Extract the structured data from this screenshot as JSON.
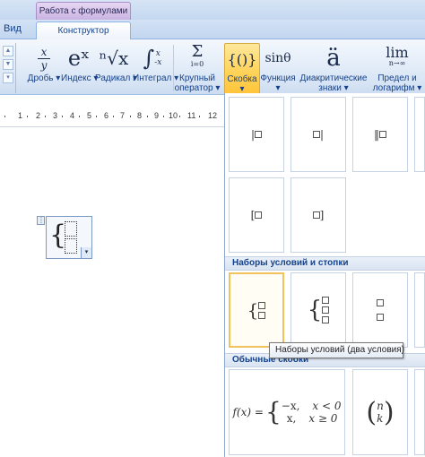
{
  "context_tab": {
    "label": "Работа с формулами"
  },
  "tabs": {
    "vid": "Вид",
    "konstruktor": "Конструктор"
  },
  "ribbon": {
    "buttons": [
      {
        "label": "Дробь",
        "glyph_top": "x",
        "glyph_bottom": "y"
      },
      {
        "label": "Индекс",
        "glyph": "eˣ"
      },
      {
        "label": "Радикал",
        "glyph": "ⁿ√x"
      },
      {
        "label": "Интеграл",
        "glyph": "∫"
      },
      {
        "label": "Крупный оператор",
        "label_line1": "Крупный",
        "label_line2": "оператор",
        "glyph": "Σ",
        "glyph_sub": "i=0"
      },
      {
        "label": "Скобка",
        "glyph": "{()}"
      },
      {
        "label": "Функция",
        "glyph": "sinθ"
      },
      {
        "label": "Диакритические знаки",
        "label_line1": "Диакритические",
        "label_line2": "знаки",
        "glyph": "ä"
      },
      {
        "label": "Предел и логарифм",
        "label_line1": "Предел и",
        "label_line2": "логарифм",
        "glyph": "lim",
        "glyph_sub": "n→∞"
      }
    ]
  },
  "ruler": {
    "numbers": [
      "1",
      "2",
      "3",
      "4",
      "5",
      "6",
      "7",
      "8",
      "9",
      "10",
      "11",
      "12"
    ]
  },
  "gallery": {
    "section_conditions": "Наборы условий и стопки",
    "section_common": "Обычные скобки",
    "tooltip": "Наборы условий (два условия)",
    "example_formula": {
      "lhs": "f(x) =",
      "row1_expr": "−x,",
      "row1_cond": "x < 0",
      "row2_expr": "x,",
      "row2_cond": "x ≥ 0"
    },
    "binomial": {
      "top": "n",
      "bottom": "k"
    }
  }
}
